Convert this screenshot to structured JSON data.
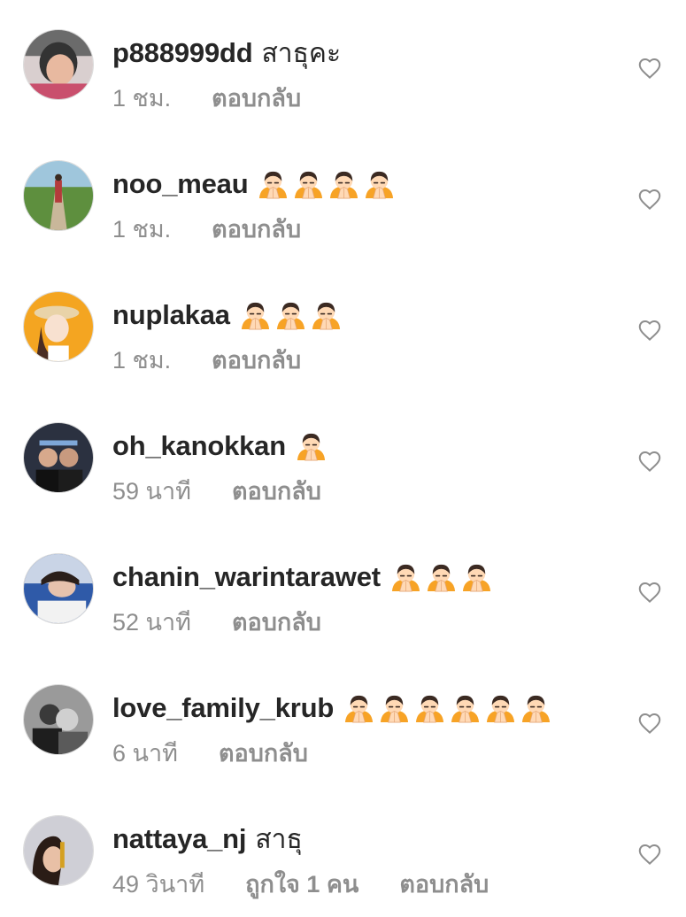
{
  "colors": {
    "text": "#262626",
    "meta": "#8e8e8e",
    "heart": "#8e8e8e",
    "emoji_orange": "#f7a326"
  },
  "reply_label": "ตอบกลับ",
  "comments": [
    {
      "username": "p888999dd",
      "text": "สาธุคะ",
      "emoji_icon": "",
      "emoji_count": 0,
      "time": "1 ชม.",
      "likes": ""
    },
    {
      "username": "noo_meau",
      "text": "",
      "emoji_icon": "person-bowing-emoji",
      "emoji_count": 4,
      "time": "1 ชม.",
      "likes": ""
    },
    {
      "username": "nuplakaa",
      "text": "",
      "emoji_icon": "person-bowing-emoji",
      "emoji_count": 3,
      "time": "1 ชม.",
      "likes": ""
    },
    {
      "username": "oh_kanokkan",
      "text": "",
      "emoji_icon": "person-bowing-emoji",
      "emoji_count": 1,
      "time": "59 นาที",
      "likes": ""
    },
    {
      "username": "chanin_warintarawet",
      "text": "",
      "emoji_icon": "person-bowing-emoji",
      "emoji_count": 3,
      "time": "52 นาที",
      "likes": ""
    },
    {
      "username": "love_family_krub",
      "text": "",
      "emoji_icon": "person-bowing-emoji",
      "emoji_count": 6,
      "time": "6 นาที",
      "likes": ""
    },
    {
      "username": "nattaya_nj",
      "text": "สาธุ",
      "emoji_icon": "",
      "emoji_count": 0,
      "time": "49 วินาที",
      "likes": "ถูกใจ 1 คน"
    }
  ]
}
